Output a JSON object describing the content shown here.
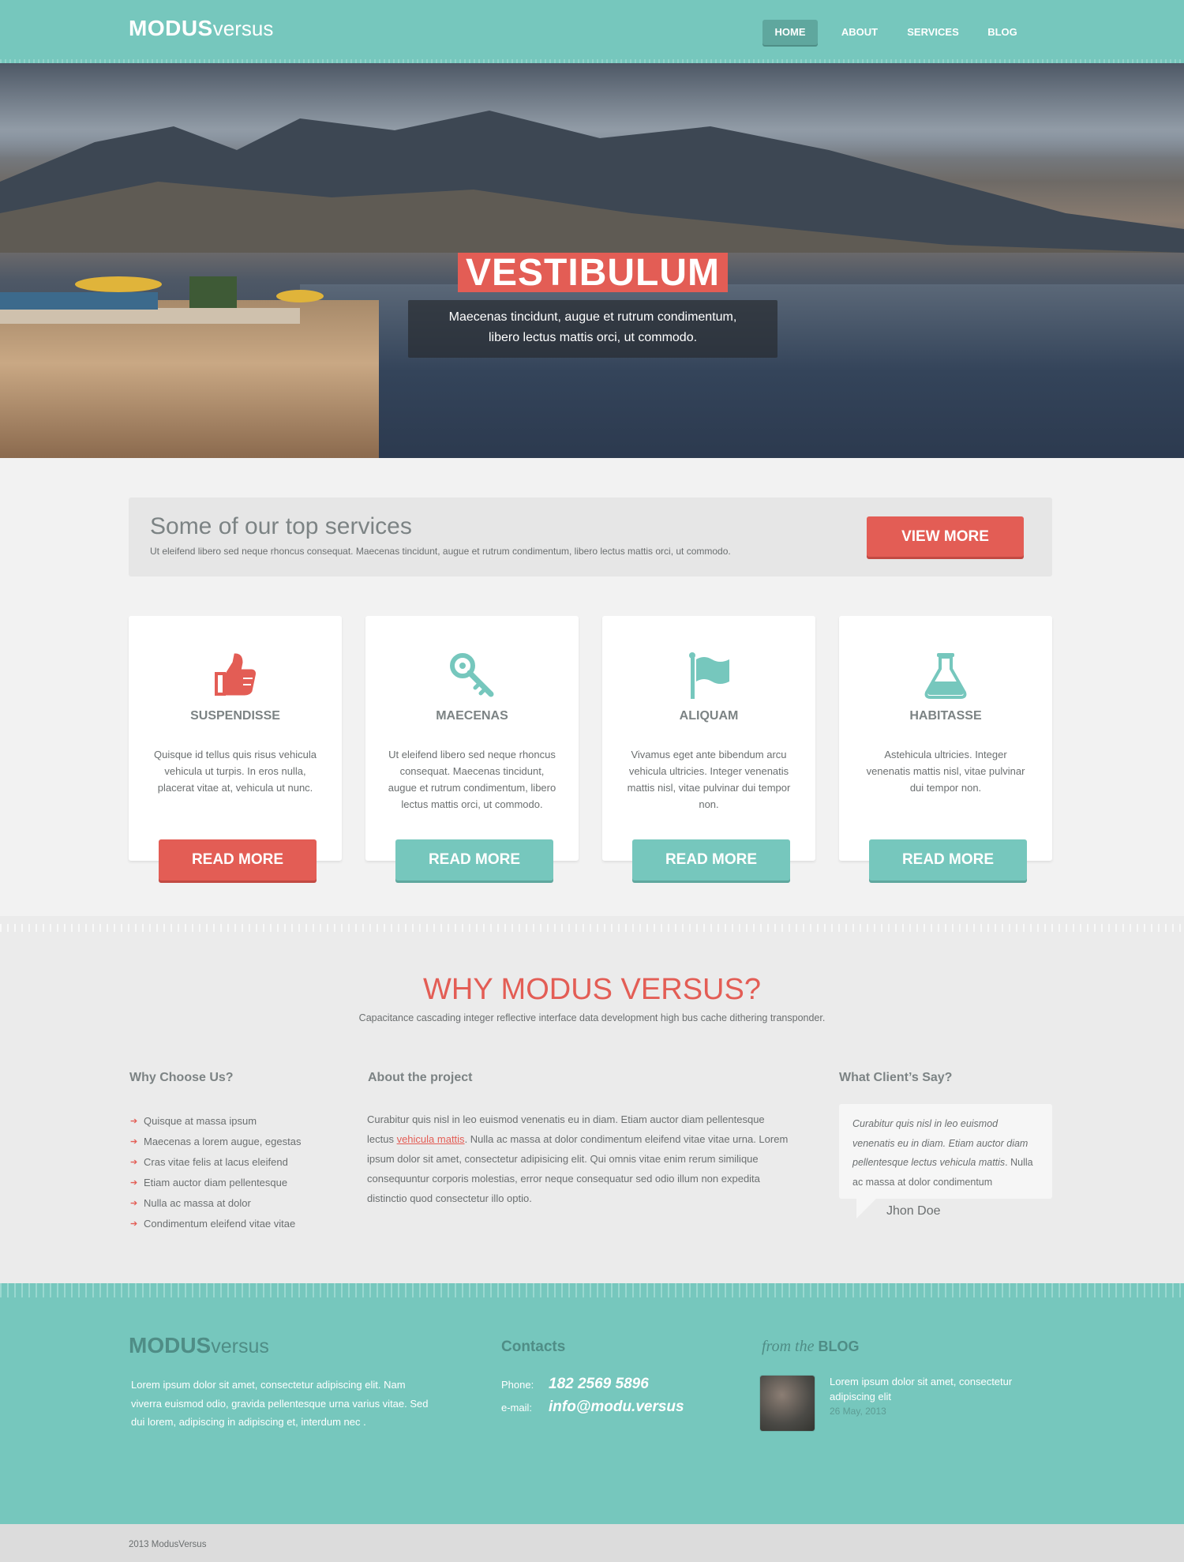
{
  "brand": {
    "bold": "MODUS",
    "light": "versus"
  },
  "nav": [
    {
      "label": "HOME",
      "active": true
    },
    {
      "label": "ABOUT",
      "active": false
    },
    {
      "label": "SERVICES",
      "active": false
    },
    {
      "label": "BLOG",
      "active": false
    }
  ],
  "hero": {
    "title": "VESTIBULUM",
    "subtitle_line1": "Maecenas tincidunt, augue et rutrum condimentum,",
    "subtitle_line2": "libero lectus mattis orci, ut commodo."
  },
  "top_services": {
    "heading": "Some of our top services",
    "text": "Ut eleifend libero sed neque rhoncus consequat. Maecenas tincidunt, augue et rutrum condimentum, libero lectus mattis orci, ut commodo.",
    "button": "VIEW MORE"
  },
  "cards": [
    {
      "icon": "thumbs-up-icon",
      "title": "SUSPENDISSE",
      "text": "Quisque id tellus quis risus vehicula vehicula ut turpis. In eros nulla, placerat vitae at, vehicula ut nunc.",
      "button": "READ MORE",
      "button_color": "#e35d55"
    },
    {
      "icon": "key-icon",
      "title": "MAECENAS",
      "text": "Ut eleifend libero sed neque rhoncus consequat. Maecenas tincidunt, augue et rutrum condimentum, libero lectus mattis orci, ut commodo.",
      "button": "READ MORE",
      "button_color": "#76c7bd"
    },
    {
      "icon": "flag-icon",
      "title": "ALIQUAM",
      "text": "Vivamus eget ante bibendum arcu vehicula ultricies. Integer venenatis mattis nisl, vitae pulvinar dui tempor non.",
      "button": "READ MORE",
      "button_color": "#76c7bd"
    },
    {
      "icon": "flask-icon",
      "title": "HABITASSE",
      "text": "Astehicula ultricies. Integer venenatis mattis nisl, vitae pulvinar dui tempor non.",
      "button": "READ MORE",
      "button_color": "#76c7bd"
    }
  ],
  "why": {
    "heading": "WHY MODUS VERSUS?",
    "subheading": "Capacitance cascading integer reflective interface data development high bus cache dithering transponder.",
    "choose_heading": "Why Choose Us?",
    "choose_items": [
      "Quisque at massa ipsum",
      "Maecenas a lorem augue, egestas",
      "Cras vitae felis at lacus eleifend",
      "Etiam auctor diam pellentesque",
      "Nulla ac massa at dolor",
      "Condimentum eleifend vitae vitae"
    ],
    "about_heading": "About the project",
    "about_pre": "Curabitur quis nisl in leo euismod venenatis eu in diam. Etiam auctor diam pellentesque lectus ",
    "about_link": "vehicula mattis",
    "about_post": ". Nulla ac massa at dolor condimentum eleifend vitae vitae urna. Lorem ipsum dolor sit amet, consectetur adipisicing elit. Qui omnis vitae enim rerum similique consequuntur corporis molestias, error neque consequatur sed odio illum non expedita distinctio quod consectetur illo optio.",
    "clients_heading": "What Client’s Say?",
    "quote_italic": "Curabitur quis nisl in leo euismod venenatis eu in diam. Etiam auctor diam pellentesque lectus vehicula mattis",
    "quote_normal": ". Nulla ac massa at dolor condimentum",
    "quote_author": "Jhon Doe"
  },
  "footer": {
    "brand_bold": "MODUS",
    "brand_light": "versus",
    "about_text": "Lorem ipsum dolor sit amet, consectetur adipiscing elit. Nam viverra euismod odio, gravida pellentesque urna varius vitae. Sed dui lorem, adipiscing in adipiscing et, interdum nec .",
    "contacts_heading": "Contacts",
    "phone_label": "Phone:",
    "phone": "182 2569 5896",
    "email_label": "e-mail:",
    "email": "info@modu.versus",
    "blog_pre": "from the",
    "blog_word": "BLOG",
    "blog_post_text": "Lorem ipsum dolor sit amet, consectetur adipiscing elit",
    "blog_post_date": "26 May, 2013",
    "copyright": "2013  ModusVersus"
  },
  "colors": {
    "teal": "#76c7bd",
    "red": "#e35d55",
    "dark_teal": "#4f8d86"
  }
}
